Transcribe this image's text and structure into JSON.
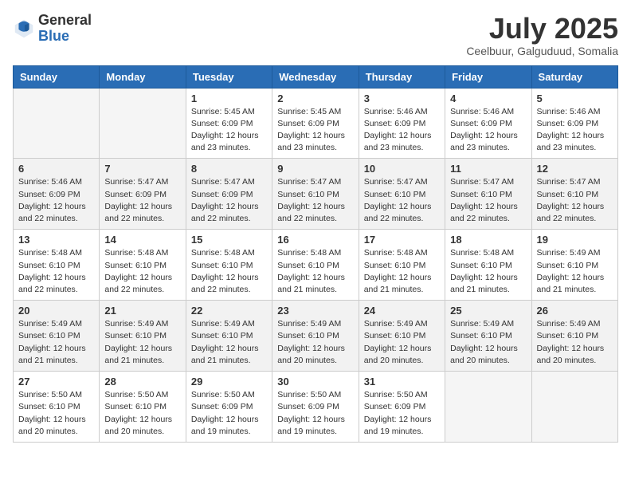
{
  "header": {
    "logo_general": "General",
    "logo_blue": "Blue",
    "month_title": "July 2025",
    "subtitle": "Ceelbuur, Galguduud, Somalia"
  },
  "days_of_week": [
    "Sunday",
    "Monday",
    "Tuesday",
    "Wednesday",
    "Thursday",
    "Friday",
    "Saturday"
  ],
  "weeks": [
    [
      {
        "day": "",
        "info": ""
      },
      {
        "day": "",
        "info": ""
      },
      {
        "day": "1",
        "info": "Sunrise: 5:45 AM\nSunset: 6:09 PM\nDaylight: 12 hours and 23 minutes."
      },
      {
        "day": "2",
        "info": "Sunrise: 5:45 AM\nSunset: 6:09 PM\nDaylight: 12 hours and 23 minutes."
      },
      {
        "day": "3",
        "info": "Sunrise: 5:46 AM\nSunset: 6:09 PM\nDaylight: 12 hours and 23 minutes."
      },
      {
        "day": "4",
        "info": "Sunrise: 5:46 AM\nSunset: 6:09 PM\nDaylight: 12 hours and 23 minutes."
      },
      {
        "day": "5",
        "info": "Sunrise: 5:46 AM\nSunset: 6:09 PM\nDaylight: 12 hours and 23 minutes."
      }
    ],
    [
      {
        "day": "6",
        "info": "Sunrise: 5:46 AM\nSunset: 6:09 PM\nDaylight: 12 hours and 22 minutes."
      },
      {
        "day": "7",
        "info": "Sunrise: 5:47 AM\nSunset: 6:09 PM\nDaylight: 12 hours and 22 minutes."
      },
      {
        "day": "8",
        "info": "Sunrise: 5:47 AM\nSunset: 6:09 PM\nDaylight: 12 hours and 22 minutes."
      },
      {
        "day": "9",
        "info": "Sunrise: 5:47 AM\nSunset: 6:10 PM\nDaylight: 12 hours and 22 minutes."
      },
      {
        "day": "10",
        "info": "Sunrise: 5:47 AM\nSunset: 6:10 PM\nDaylight: 12 hours and 22 minutes."
      },
      {
        "day": "11",
        "info": "Sunrise: 5:47 AM\nSunset: 6:10 PM\nDaylight: 12 hours and 22 minutes."
      },
      {
        "day": "12",
        "info": "Sunrise: 5:47 AM\nSunset: 6:10 PM\nDaylight: 12 hours and 22 minutes."
      }
    ],
    [
      {
        "day": "13",
        "info": "Sunrise: 5:48 AM\nSunset: 6:10 PM\nDaylight: 12 hours and 22 minutes."
      },
      {
        "day": "14",
        "info": "Sunrise: 5:48 AM\nSunset: 6:10 PM\nDaylight: 12 hours and 22 minutes."
      },
      {
        "day": "15",
        "info": "Sunrise: 5:48 AM\nSunset: 6:10 PM\nDaylight: 12 hours and 22 minutes."
      },
      {
        "day": "16",
        "info": "Sunrise: 5:48 AM\nSunset: 6:10 PM\nDaylight: 12 hours and 21 minutes."
      },
      {
        "day": "17",
        "info": "Sunrise: 5:48 AM\nSunset: 6:10 PM\nDaylight: 12 hours and 21 minutes."
      },
      {
        "day": "18",
        "info": "Sunrise: 5:48 AM\nSunset: 6:10 PM\nDaylight: 12 hours and 21 minutes."
      },
      {
        "day": "19",
        "info": "Sunrise: 5:49 AM\nSunset: 6:10 PM\nDaylight: 12 hours and 21 minutes."
      }
    ],
    [
      {
        "day": "20",
        "info": "Sunrise: 5:49 AM\nSunset: 6:10 PM\nDaylight: 12 hours and 21 minutes."
      },
      {
        "day": "21",
        "info": "Sunrise: 5:49 AM\nSunset: 6:10 PM\nDaylight: 12 hours and 21 minutes."
      },
      {
        "day": "22",
        "info": "Sunrise: 5:49 AM\nSunset: 6:10 PM\nDaylight: 12 hours and 21 minutes."
      },
      {
        "day": "23",
        "info": "Sunrise: 5:49 AM\nSunset: 6:10 PM\nDaylight: 12 hours and 20 minutes."
      },
      {
        "day": "24",
        "info": "Sunrise: 5:49 AM\nSunset: 6:10 PM\nDaylight: 12 hours and 20 minutes."
      },
      {
        "day": "25",
        "info": "Sunrise: 5:49 AM\nSunset: 6:10 PM\nDaylight: 12 hours and 20 minutes."
      },
      {
        "day": "26",
        "info": "Sunrise: 5:49 AM\nSunset: 6:10 PM\nDaylight: 12 hours and 20 minutes."
      }
    ],
    [
      {
        "day": "27",
        "info": "Sunrise: 5:50 AM\nSunset: 6:10 PM\nDaylight: 12 hours and 20 minutes."
      },
      {
        "day": "28",
        "info": "Sunrise: 5:50 AM\nSunset: 6:10 PM\nDaylight: 12 hours and 20 minutes."
      },
      {
        "day": "29",
        "info": "Sunrise: 5:50 AM\nSunset: 6:09 PM\nDaylight: 12 hours and 19 minutes."
      },
      {
        "day": "30",
        "info": "Sunrise: 5:50 AM\nSunset: 6:09 PM\nDaylight: 12 hours and 19 minutes."
      },
      {
        "day": "31",
        "info": "Sunrise: 5:50 AM\nSunset: 6:09 PM\nDaylight: 12 hours and 19 minutes."
      },
      {
        "day": "",
        "info": ""
      },
      {
        "day": "",
        "info": ""
      }
    ]
  ]
}
